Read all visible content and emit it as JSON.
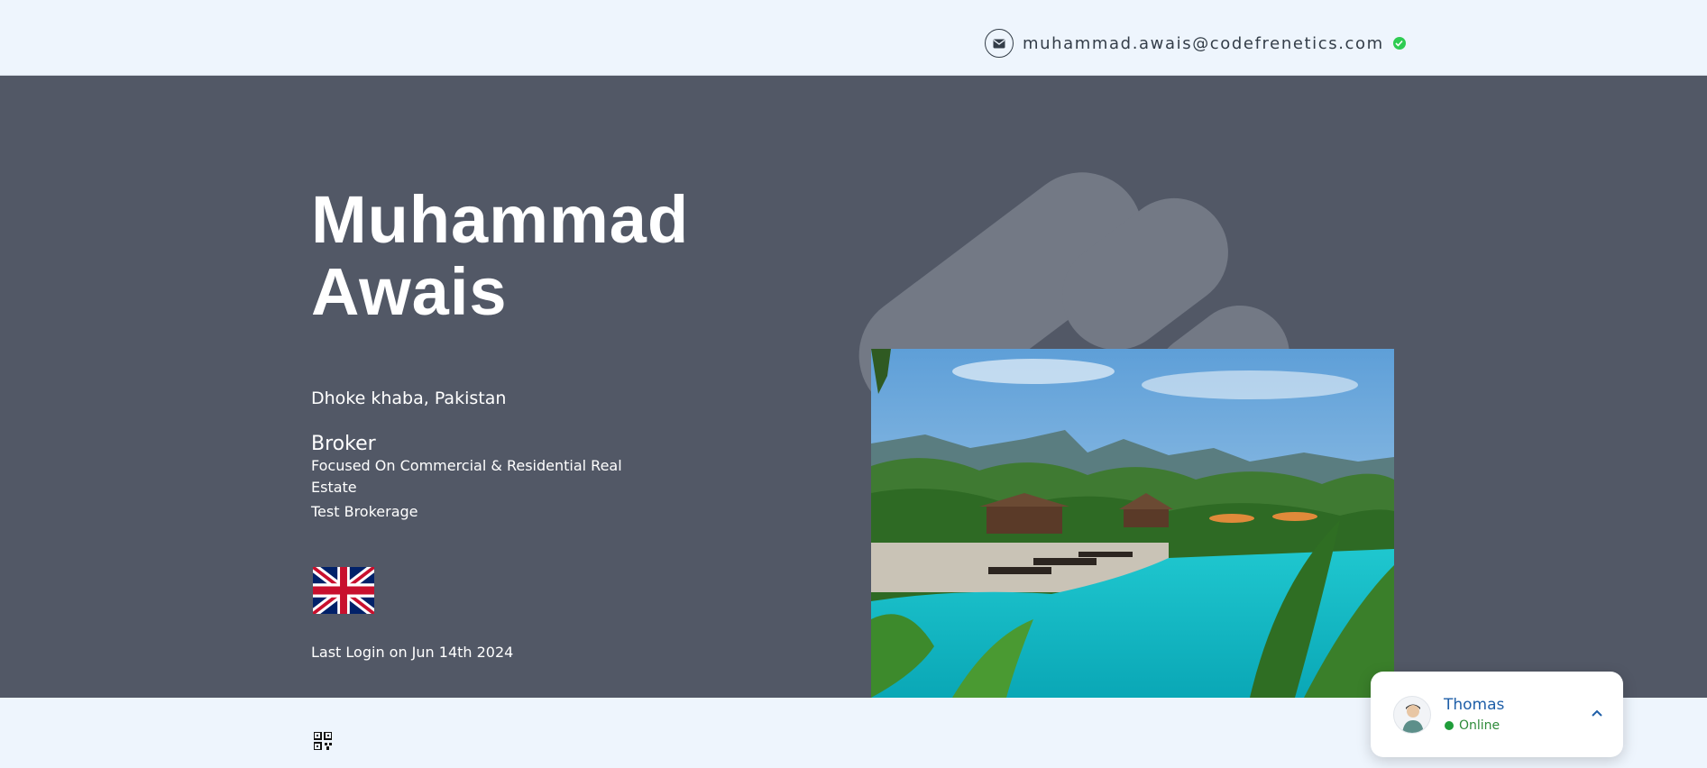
{
  "header": {
    "email": "muhammad.awais@codefrenetics.com",
    "email_icon": "envelope-icon",
    "verified_icon": "verified-check-icon"
  },
  "profile": {
    "first_name": "Muhammad",
    "last_name": "Awais",
    "location": "Dhoke khaba,  Pakistan",
    "role": "Broker",
    "focus": "Focused On Commercial & Residential Real Estate",
    "brokerage": "Test Brokerage",
    "flag_icon": "uk-flag-icon",
    "last_login": "Last Login on Jun 14th 2024"
  },
  "footer": {
    "qr_icon": "qr-code-icon"
  },
  "chat_widget": {
    "name": "Thomas",
    "status": "Online",
    "expand_icon": "chevron-up-icon"
  },
  "colors": {
    "hero_bg": "#525866",
    "page_bg": "#eef5fd",
    "accent_blue": "#1f5fa8",
    "online_green": "#1f9d3a",
    "verified_green": "#2ecc52"
  }
}
